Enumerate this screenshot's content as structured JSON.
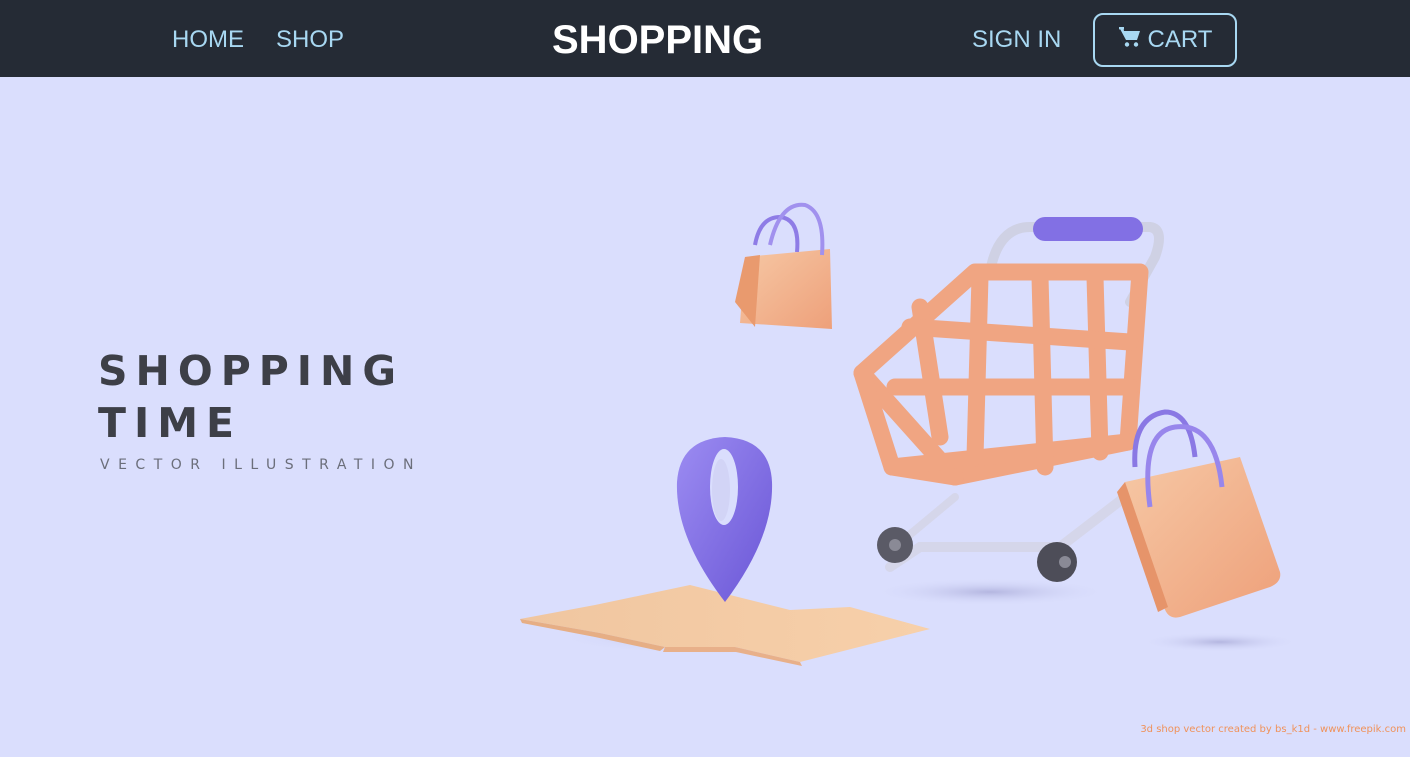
{
  "nav": {
    "home": "HOME",
    "shop": "SHOP",
    "brand": "SHOPPING",
    "sign_in": "SIGN IN",
    "cart": "CART",
    "cart_icon": "shopping-cart-icon"
  },
  "hero": {
    "title_line1": "SHOPPING",
    "title_line2": "TIME",
    "subtitle": "VECTOR ILLUSTRATION",
    "credit": "3d shop vector created by bs_k1d - www.freepik.com"
  },
  "colors": {
    "navbar_bg": "#252b35",
    "nav_link": "#a8d8f2",
    "hero_bg": "#dadefd",
    "cart_orange": "#f2a27c",
    "pin_purple": "#7d6be0",
    "credit": "#f0925a"
  }
}
